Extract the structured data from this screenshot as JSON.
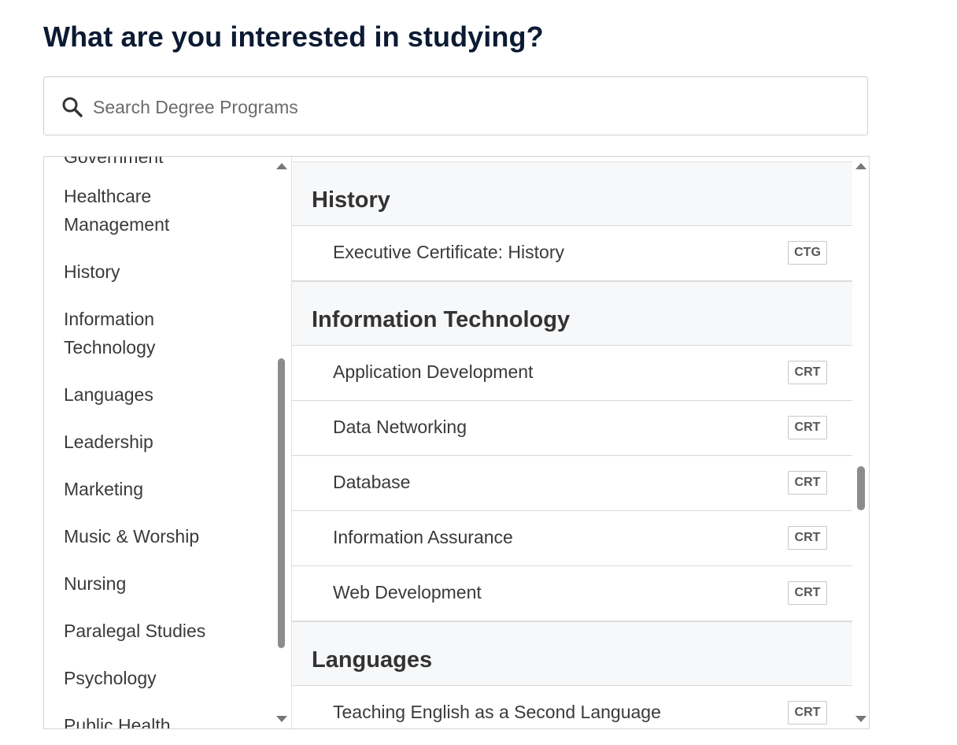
{
  "page": {
    "title": "What are you interested in studying?"
  },
  "search": {
    "placeholder": "Search Degree Programs",
    "icon": "search-icon"
  },
  "categories": [
    "Government",
    "Healthcare Management",
    "History",
    "Information Technology",
    "Languages",
    "Leadership",
    "Marketing",
    "Music & Worship",
    "Nursing",
    "Paralegal Studies",
    "Psychology",
    "Public Health"
  ],
  "groups": [
    {
      "heading": "History",
      "programs": [
        {
          "name": "Executive Certificate: History",
          "badge": "CTG"
        }
      ]
    },
    {
      "heading": "Information Technology",
      "programs": [
        {
          "name": "Application Development",
          "badge": "CRT"
        },
        {
          "name": "Data Networking",
          "badge": "CRT"
        },
        {
          "name": "Database",
          "badge": "CRT"
        },
        {
          "name": "Information Assurance",
          "badge": "CRT"
        },
        {
          "name": "Web Development",
          "badge": "CRT"
        }
      ]
    },
    {
      "heading": "Languages",
      "programs": [
        {
          "name": "Teaching English as a Second Language",
          "badge": "CRT"
        }
      ]
    }
  ]
}
